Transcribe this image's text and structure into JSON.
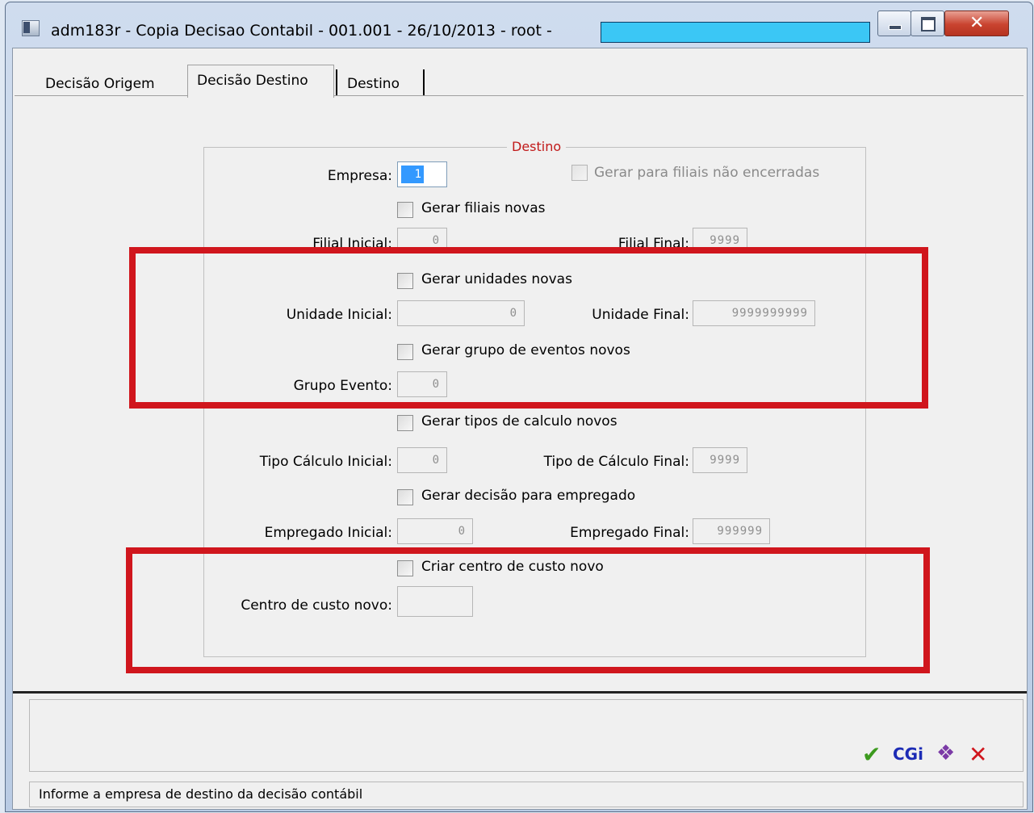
{
  "window": {
    "title": "adm183r - Copia Decisao Contabil - 001.001 - 26/10/2013 - root -",
    "close_glyph": "✕"
  },
  "tabs": [
    {
      "label": "Decisão Origem"
    },
    {
      "label": "Decisão Destino"
    },
    {
      "label": "Destino"
    }
  ],
  "group": {
    "legend": "Destino",
    "empresa_label": "Empresa:",
    "empresa_value": "1",
    "gerar_filiais_nao_encerradas": "Gerar para filiais não encerradas",
    "gerar_filiais_novas": "Gerar filiais novas",
    "filial_inicial_label": "Filial Inicial:",
    "filial_inicial_value": "0",
    "filial_final_label": "Filial Final:",
    "filial_final_value": "9999",
    "gerar_unidades_novas": "Gerar unidades novas",
    "unidade_inicial_label": "Unidade Inicial:",
    "unidade_inicial_value": "0",
    "unidade_final_label": "Unidade Final:",
    "unidade_final_value": "9999999999",
    "gerar_grupo_eventos": "Gerar grupo de eventos novos",
    "grupo_evento_label": "Grupo Evento:",
    "grupo_evento_value": "0",
    "gerar_tipos_calculo": "Gerar tipos de calculo novos",
    "tipo_calculo_inicial_label": "Tipo Cálculo Inicial:",
    "tipo_calculo_inicial_value": "0",
    "tipo_calculo_final_label": "Tipo de Cálculo Final:",
    "tipo_calculo_final_value": "9999",
    "gerar_decisao_empregado": "Gerar decisão para empregado",
    "empregado_inicial_label": "Empregado Inicial:",
    "empregado_inicial_value": "0",
    "empregado_final_label": "Empregado Final:",
    "empregado_final_value": "999999",
    "criar_centro_custo": "Criar centro de custo novo",
    "centro_custo_label": "Centro de custo novo:",
    "centro_custo_value": ""
  },
  "toolbar": {
    "ok_glyph": "✔",
    "cgi_label": "CGi",
    "help_glyph": "❖",
    "cancel_glyph": "✕"
  },
  "status": {
    "text": "Informe a empresa de destino da decisão contábil"
  },
  "colors": {
    "highlight_red": "#d0161d",
    "legend_red": "#c11a1a",
    "selection_blue": "#3399ff",
    "redaction_cyan": "#3bc7f5"
  }
}
